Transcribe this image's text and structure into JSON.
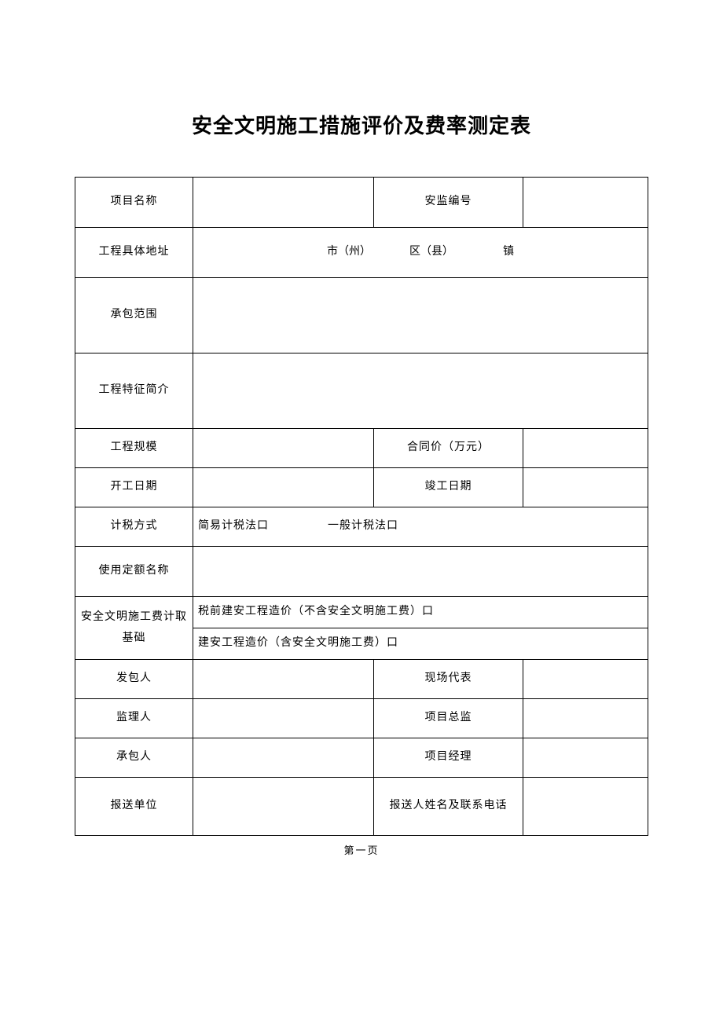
{
  "title": "安全文明施工措施评价及费率测定表",
  "rows": {
    "r1": {
      "label": "项目名称",
      "v1": "",
      "label2": "安监编号",
      "v2": ""
    },
    "r2": {
      "label": "工程具体地址",
      "content": "市（州）　　　　区（县）　　　　　镇"
    },
    "r3": {
      "label": "承包范围",
      "content": ""
    },
    "r4": {
      "label": "工程特征简介",
      "content": ""
    },
    "r5": {
      "label": "工程规模",
      "v1": "",
      "label2": "合同价（万元）",
      "v2": ""
    },
    "r6": {
      "label": "开工日期",
      "v1": "",
      "label2": "竣工日期",
      "v2": ""
    },
    "r7": {
      "label": "计税方式",
      "content": "简易计税法口　　　　　一般计税法口"
    },
    "r8": {
      "label": "使用定额名称",
      "content": ""
    },
    "r9": {
      "label": "安全文明施工费计取基础",
      "line1": "税前建安工程造价（不含安全文明施工费）口",
      "line2": "建安工程造价（含安全文明施工费）口"
    },
    "r10": {
      "label": "发包人",
      "v1": "",
      "label2": "现场代表",
      "v2": ""
    },
    "r11": {
      "label": "监理人",
      "v1": "",
      "label2": "项目总监",
      "v2": ""
    },
    "r12": {
      "label": "承包人",
      "v1": "",
      "label2": "项目经理",
      "v2": ""
    },
    "r13": {
      "label": "报送单位",
      "v1": "",
      "label2": "报送人姓名及联系电话",
      "v2": ""
    }
  },
  "footer": "第一页"
}
